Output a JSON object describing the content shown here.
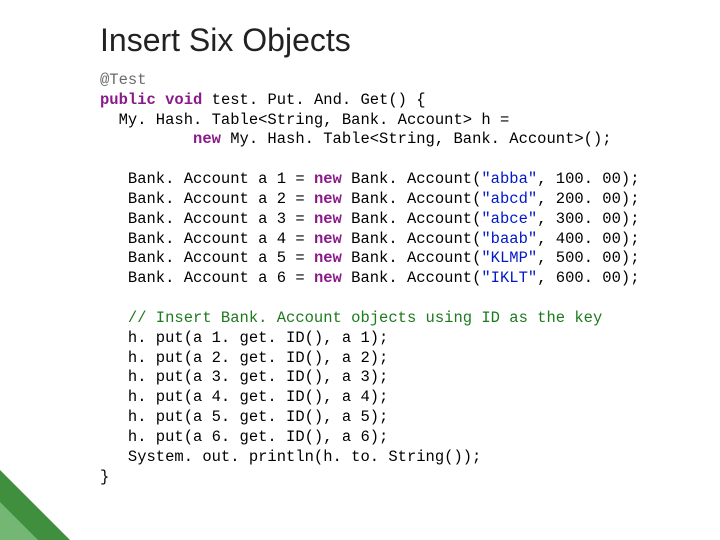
{
  "slide": {
    "title": "Insert Six Objects",
    "code": {
      "anno": "@Test",
      "decl_public": "public",
      "decl_void": "void",
      "decl_rest": " test. Put. And. Get() {",
      "hashdecl1": "  My. Hash. Table<String, Bank. Account> h =",
      "hashdecl2_pre": "          ",
      "hashdecl2_new": "new",
      "hashdecl2_rest": " My. Hash. Table<String, Bank. Account>();",
      "rows": [
        {
          "pre": "   Bank. Account a 1 = ",
          "new": "new",
          "mid": " Bank. Account(",
          "str": "\"abba\"",
          "tail": ", 100. 00);"
        },
        {
          "pre": "   Bank. Account a 2 = ",
          "new": "new",
          "mid": " Bank. Account(",
          "str": "\"abcd\"",
          "tail": ", 200. 00);"
        },
        {
          "pre": "   Bank. Account a 3 = ",
          "new": "new",
          "mid": " Bank. Account(",
          "str": "\"abce\"",
          "tail": ", 300. 00);"
        },
        {
          "pre": "   Bank. Account a 4 = ",
          "new": "new",
          "mid": " Bank. Account(",
          "str": "\"baab\"",
          "tail": ", 400. 00);"
        },
        {
          "pre": "   Bank. Account a 5 = ",
          "new": "new",
          "mid": " Bank. Account(",
          "str": "\"KLMP\"",
          "tail": ", 500. 00);"
        },
        {
          "pre": "   Bank. Account a 6 = ",
          "new": "new",
          "mid": " Bank. Account(",
          "str": "\"IKLT\"",
          "tail": ", 600. 00);"
        }
      ],
      "comment": "   // Insert Bank. Account objects using ID as the key",
      "puts": [
        "   h. put(a 1. get. ID(), a 1);",
        "   h. put(a 2. get. ID(), a 2);",
        "   h. put(a 3. get. ID(), a 3);",
        "   h. put(a 4. get. ID(), a 4);",
        "   h. put(a 5. get. ID(), a 5);",
        "   h. put(a 6. get. ID(), a 6);"
      ],
      "println": "   System. out. println(h. to. String());",
      "close": "}"
    }
  }
}
